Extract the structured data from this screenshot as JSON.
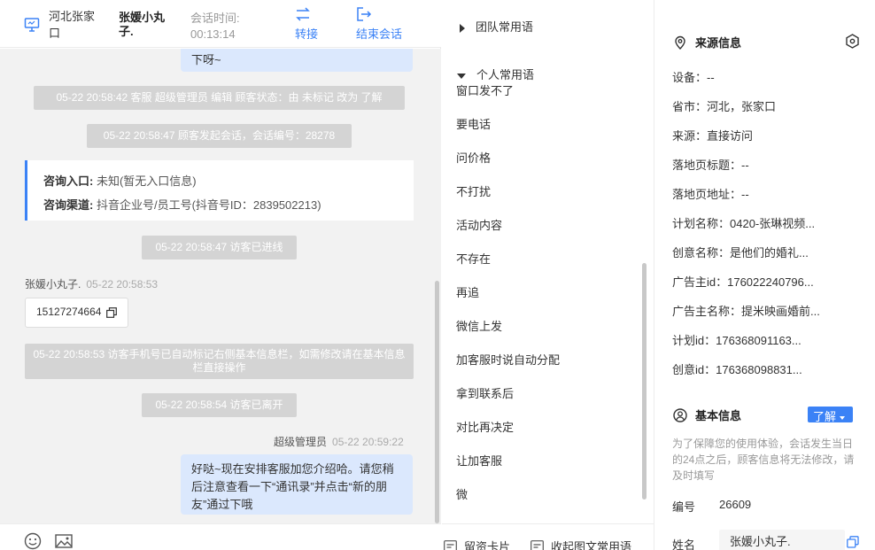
{
  "header": {
    "location": "河北张家口",
    "customer_name": "张媛小丸子.",
    "session_time_label": "会话时间:",
    "session_time_value": "00:13:14",
    "transfer_label": "转接",
    "end_session_label": "结束会话"
  },
  "chat": {
    "prev_bubble_tail": "下呀~",
    "sys_messages": [
      "05-22 20:58:42 客服 超级管理员 编辑 顾客状态：由 未标记 改为 了解",
      "05-22 20:58:47 顾客发起会话，会话编号：28278",
      "05-22 20:58:47 访客已进线",
      "05-22 20:58:53 访客手机号已自动标记右侧基本信息栏，如需修改请在基本信息栏直接操作",
      "05-22 20:58:54 访客已离开"
    ],
    "consult": {
      "entry_label": "咨询入口:",
      "entry_value": "未知(暂无入口信息)",
      "channel_label": "咨询渠道:",
      "channel_value": "抖音企业号/员工号(抖音号ID：2839502213)"
    },
    "customer_sender": "张媛小丸子.",
    "customer_time": "05-22 20:58:53",
    "customer_phone": "15127274664",
    "agent_sender": "超级管理员",
    "agent_time": "05-22 20:59:22",
    "agent_message": "好哒~现在安排客服加您介绍哈。请您稍后注意查看一下“通讯录”并点击“新的朋友”通过下哦"
  },
  "phrases": {
    "team_group": "团队常用语",
    "personal_group": "个人常用语",
    "items": [
      "窗口发不了",
      "要电话",
      "问价格",
      "不打扰",
      "活动内容",
      "不存在",
      "再追",
      "微信上发",
      "加客服时说自动分配",
      "拿到联系后",
      "对比再决定",
      "让加客服",
      "微"
    ],
    "footer_card": "留资卡片",
    "footer_collect": "收起图文常用语"
  },
  "info": {
    "source_title": "来源信息",
    "rows": [
      "设备：--",
      "省市：河北，张家口",
      "来源：直接访问",
      "落地页标题：--",
      "落地页地址：--",
      "计划名称：0420-张琳视频...",
      "创意名称：是他们的婚礼...",
      "广告主id：176022240796...",
      "广告主名称：提米映画婚前...",
      "计划id：176368091163...",
      "创意id：176368098831..."
    ],
    "basic_title": "基本信息",
    "learn_label": "了解",
    "notice": "为了保障您的使用体验，会话发生当日的24点之后，顾客信息将无法修改，请及时填写",
    "id_label": "编号",
    "id_value": "26609",
    "name_label": "姓名",
    "name_value": "张媛小丸子."
  },
  "colors": {
    "accent": "#3b82f6",
    "agent_bubble": "#dbe8fd",
    "system_msg": "#d4d4d4"
  }
}
